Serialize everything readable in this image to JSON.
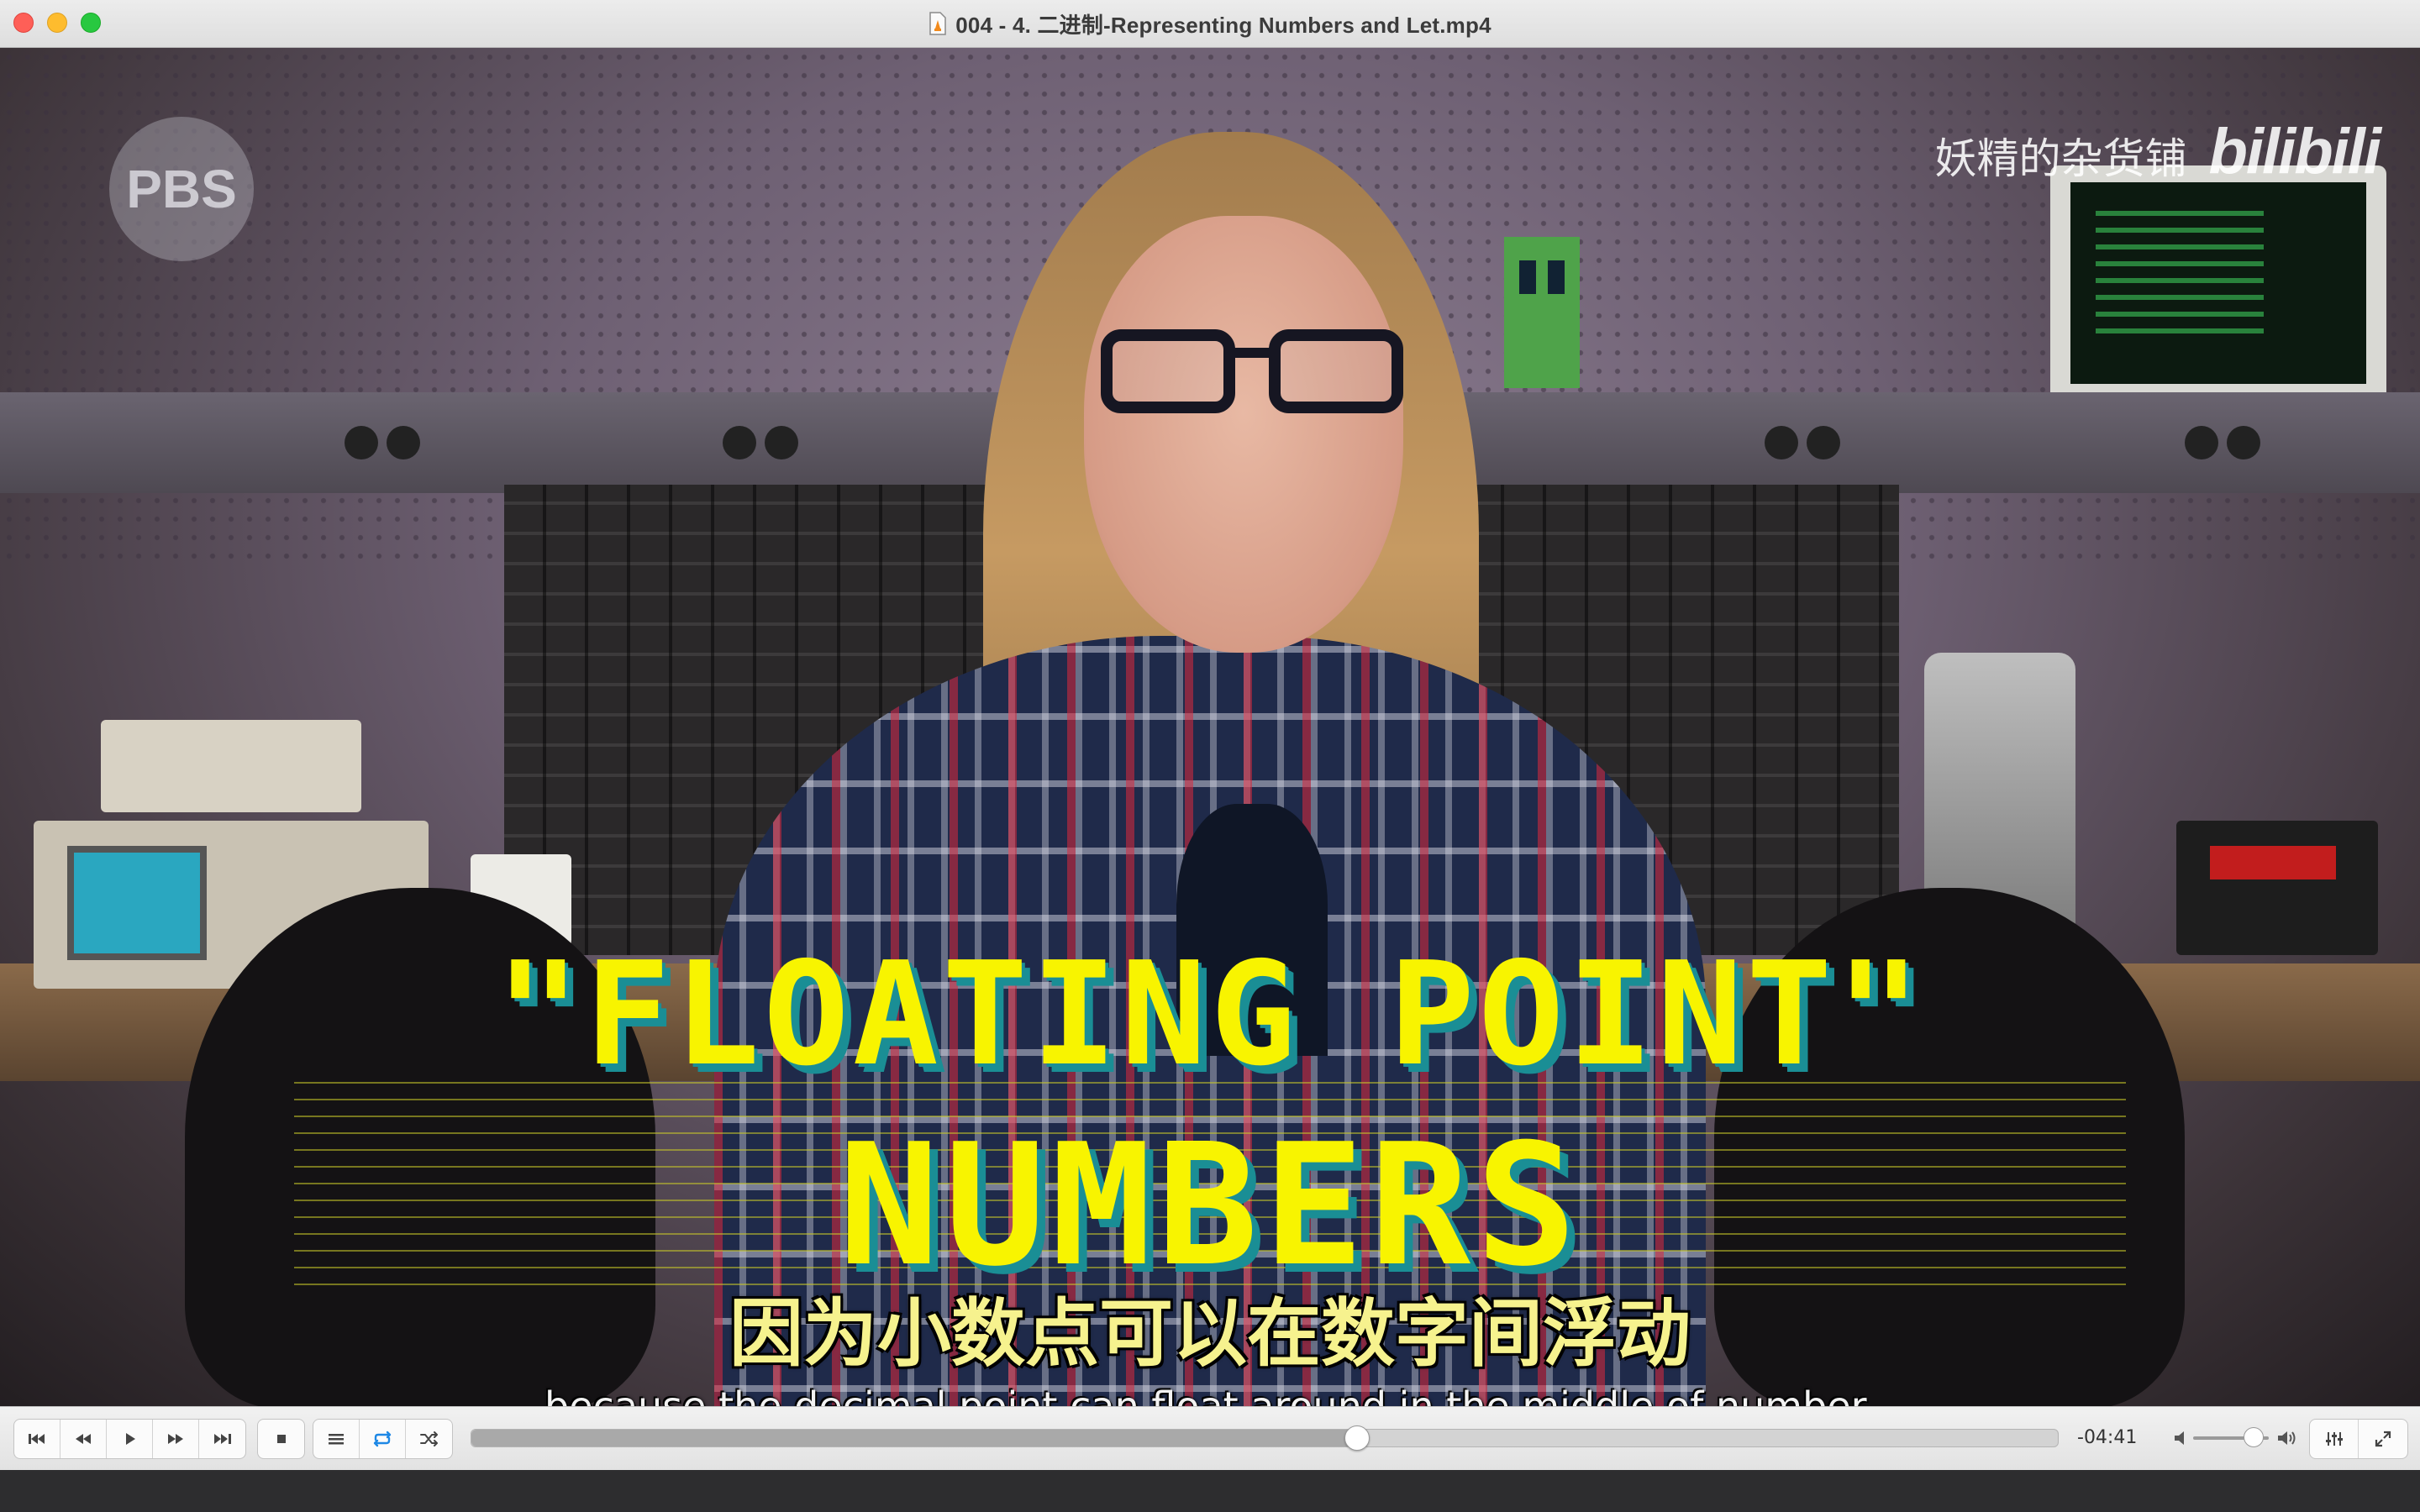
{
  "window": {
    "title": "004 - 4. 二进制-Representing Numbers and Let.mp4",
    "file_icon": "vlc-document-icon"
  },
  "video": {
    "watermark_text": "妖精的杂货铺",
    "watermark_logo": "bilibili",
    "channel_logo": "PBS",
    "overlay_line1": "\"FLOATING POINT\"",
    "overlay_line2": "NUMBERS",
    "subtitle_cn": "因为小数点可以在数字间浮动",
    "subtitle_en": "because the decimal point can float around in the middle of number."
  },
  "controls": {
    "buttons_left": [
      "skip-back-icon",
      "rewind-icon",
      "play-icon",
      "fast-forward-icon",
      "skip-forward-icon"
    ],
    "stop": "stop-icon",
    "playlist": "playlist-icon",
    "loop": "loop-icon",
    "shuffle": "shuffle-icon",
    "time_remaining": "-04:41",
    "progress_fraction": 0.558,
    "volume_fraction": 0.8,
    "equalizer": "equalizer-icon",
    "fullscreen": "fullscreen-icon",
    "accent_color": "#1e88e5"
  }
}
